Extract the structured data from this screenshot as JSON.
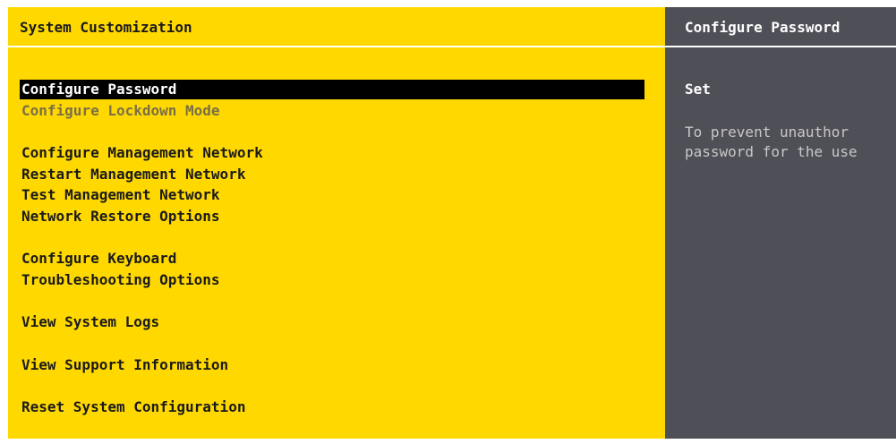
{
  "left_panel": {
    "title": "System Customization",
    "menu_items": [
      {
        "label": "Configure Password",
        "state": "selected"
      },
      {
        "label": "Configure Lockdown Mode",
        "state": "disabled"
      },
      {
        "label": "Configure Management Network",
        "state": "normal"
      },
      {
        "label": "Restart Management Network",
        "state": "normal"
      },
      {
        "label": "Test Management Network",
        "state": "normal"
      },
      {
        "label": "Network Restore Options",
        "state": "normal"
      },
      {
        "label": "Configure Keyboard",
        "state": "normal"
      },
      {
        "label": "Troubleshooting Options",
        "state": "normal"
      },
      {
        "label": "View System Logs",
        "state": "normal"
      },
      {
        "label": "View Support Information",
        "state": "normal"
      },
      {
        "label": "Reset System Configuration",
        "state": "normal"
      }
    ]
  },
  "right_panel": {
    "title": "Configure Password",
    "status": "Set",
    "description_lines": [
      "To prevent unauthor",
      "password for the use"
    ]
  },
  "colors": {
    "left_background": "#ffd800",
    "right_background": "#4f4f57",
    "selected_background": "#000000",
    "selected_text": "#ffffff",
    "disabled_text": "#7a6f46"
  }
}
